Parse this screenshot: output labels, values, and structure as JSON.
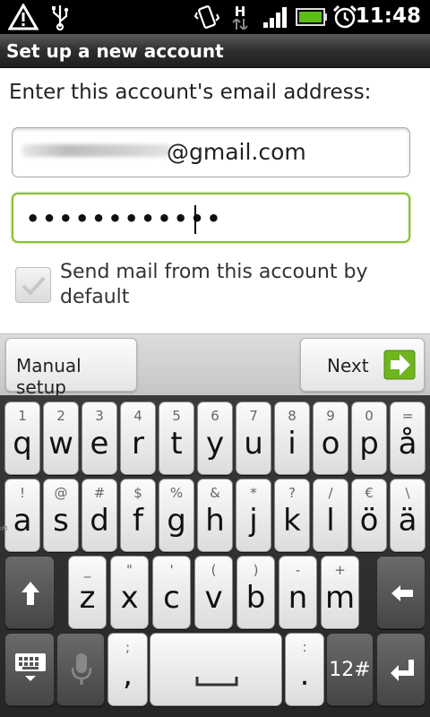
{
  "status_bar": {
    "time": "11:48",
    "icons": [
      "warning-icon",
      "usb-icon",
      "vibrate-icon",
      "hspa-data-icon",
      "signal-icon",
      "battery-icon",
      "alarm-icon"
    ],
    "network_type": "H"
  },
  "title_bar": {
    "title": "Set up a new account"
  },
  "form": {
    "prompt": "Enter this account's email address:",
    "email_value": "@gmail.com",
    "password_value": "••••••••••••",
    "default_checkbox": {
      "label": "Send mail from this account by default",
      "checked": true
    }
  },
  "actions": {
    "manual_setup": "Manual setup",
    "next": "Next"
  },
  "keyboard": {
    "row1": [
      {
        "num": "1",
        "ch": "q"
      },
      {
        "num": "2",
        "ch": "w"
      },
      {
        "num": "3",
        "ch": "e"
      },
      {
        "num": "4",
        "ch": "r"
      },
      {
        "num": "5",
        "ch": "t"
      },
      {
        "num": "6",
        "ch": "y"
      },
      {
        "num": "7",
        "ch": "u"
      },
      {
        "num": "8",
        "ch": "i"
      },
      {
        "num": "9",
        "ch": "o"
      },
      {
        "num": "0",
        "ch": "p"
      },
      {
        "num": "=",
        "ch": "å"
      }
    ],
    "row2": [
      {
        "num": "!",
        "ch": "a"
      },
      {
        "num": "@",
        "ch": "s"
      },
      {
        "num": "#",
        "ch": "d"
      },
      {
        "num": "$",
        "ch": "f"
      },
      {
        "num": "%",
        "ch": "g"
      },
      {
        "num": "&",
        "ch": "h"
      },
      {
        "num": "*",
        "ch": "j"
      },
      {
        "num": "?",
        "ch": "k"
      },
      {
        "num": "/",
        "ch": "l"
      },
      {
        "num": "€",
        "ch": "ö"
      },
      {
        "num": "\\",
        "ch": "ä"
      }
    ],
    "row3": [
      {
        "num": "_",
        "ch": "z"
      },
      {
        "num": "\"",
        "ch": "x"
      },
      {
        "num": "'",
        "ch": "c"
      },
      {
        "num": "(",
        "ch": "v"
      },
      {
        "num": ")",
        "ch": "b"
      },
      {
        "num": "-",
        "ch": "n"
      },
      {
        "num": "+",
        "ch": "m"
      }
    ],
    "comma": {
      "num": ";",
      "ch": ","
    },
    "period": {
      "num": ":",
      "ch": "."
    },
    "symbols_label": "12#",
    "side_label": "ä"
  },
  "colors": {
    "focus_accent": "#8cc034",
    "next_arrow": "#6fb51c"
  }
}
